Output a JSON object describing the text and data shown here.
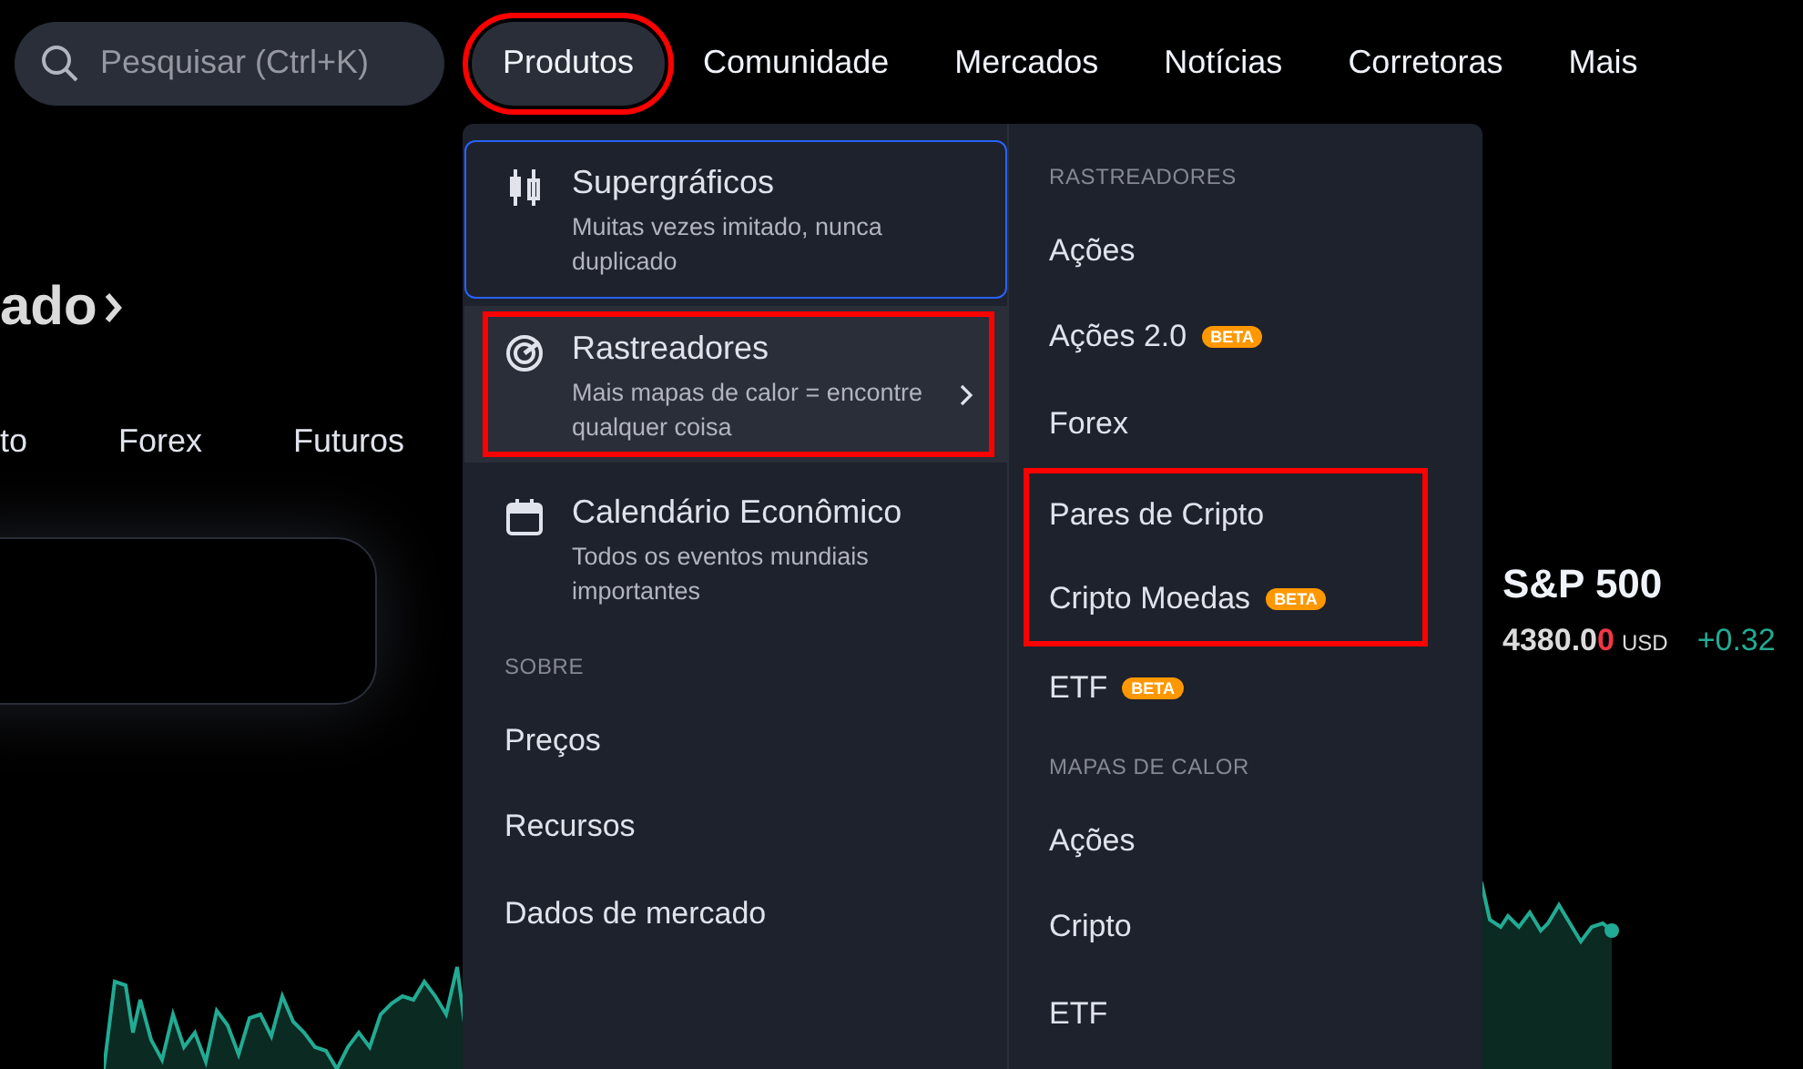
{
  "nav": {
    "search": {
      "placeholder": "Pesquisar (Ctrl+K)"
    },
    "items": [
      {
        "label": "Produtos",
        "selected": true,
        "highlighted": true
      },
      {
        "label": "Comunidade",
        "selected": false,
        "highlighted": false
      },
      {
        "label": "Mercados",
        "selected": false,
        "highlighted": false
      },
      {
        "label": "Notícias",
        "selected": false,
        "highlighted": false
      },
      {
        "label": "Corretoras",
        "selected": false,
        "highlighted": false
      },
      {
        "label": "Mais",
        "selected": false,
        "highlighted": false
      }
    ]
  },
  "background": {
    "heading": "ado",
    "market_tabs": [
      "to",
      "Forex",
      "Futuros"
    ],
    "index_quote": {
      "name": "S&P 500",
      "price": "4380.0",
      "price_last_digit": "0",
      "currency": "USD",
      "change": "+0.32"
    }
  },
  "menu": {
    "products": [
      {
        "kind": "chart",
        "title": "Supergráficos",
        "description": "Muitas vezes imitado, nunca duplicado",
        "focused": true,
        "hovered": false,
        "highlighted": false,
        "has_submenu": false
      },
      {
        "kind": "screener",
        "title": "Rastreadores",
        "description": "Mais mapas de calor = encontre qualquer coisa",
        "focused": false,
        "hovered": true,
        "highlighted": true,
        "has_submenu": true
      },
      {
        "kind": "calendar",
        "title": "Calendário Econômico",
        "description": "Todos os eventos mundiais importantes",
        "focused": false,
        "hovered": false,
        "highlighted": false,
        "has_submenu": false
      }
    ],
    "about": {
      "header": "SOBRE",
      "links": [
        "Preços",
        "Recursos",
        "Dados de mercado"
      ]
    },
    "sections": [
      {
        "header": "RASTREADORES",
        "items": [
          {
            "label": "Ações",
            "highlighted": false
          },
          {
            "label": "Ações 2.0",
            "badge": "BETA",
            "highlighted": false
          },
          {
            "label": "Forex",
            "highlighted": false
          },
          {
            "label": "Pares de Cripto",
            "highlighted": true
          },
          {
            "label": "Cripto Moedas",
            "badge": "BETA",
            "highlighted": true
          },
          {
            "label": "ETF",
            "badge": "BETA",
            "highlighted": false
          }
        ]
      },
      {
        "header": "MAPAS DE CALOR",
        "items": [
          {
            "label": "Ações",
            "highlighted": false
          },
          {
            "label": "Cripto",
            "highlighted": false
          },
          {
            "label": "ETF",
            "highlighted": false
          }
        ]
      }
    ]
  }
}
